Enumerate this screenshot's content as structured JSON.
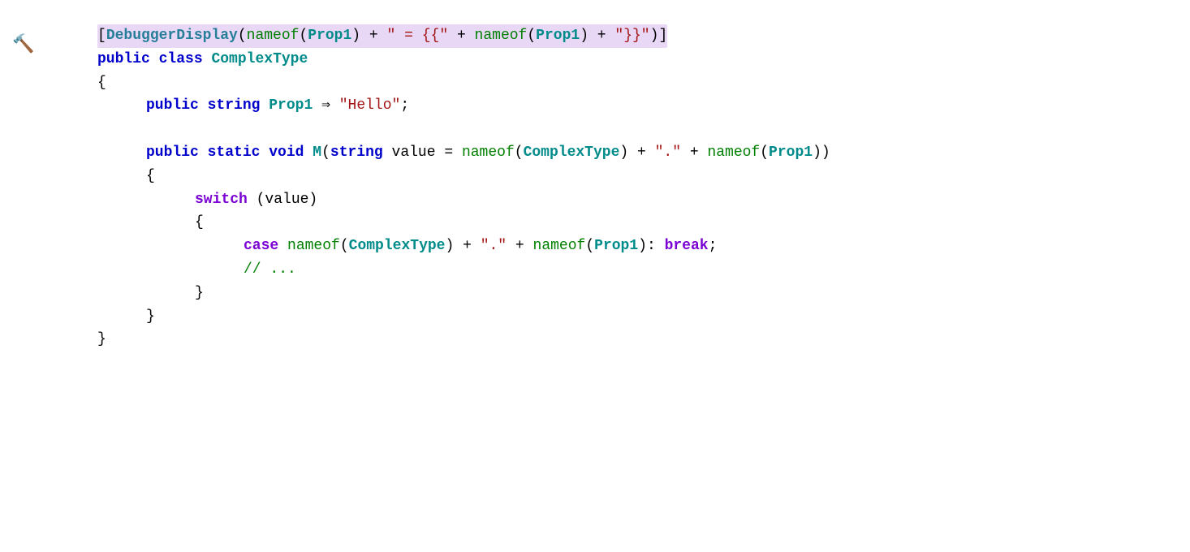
{
  "code": {
    "lines": [
      {
        "id": "line1",
        "indent": 0,
        "tokens": [
          {
            "text": "[",
            "class": "punct",
            "highlight": true
          },
          {
            "text": "DebuggerDisplay",
            "class": "attr-class",
            "highlight": true
          },
          {
            "text": "(",
            "class": "punct",
            "highlight": true
          },
          {
            "text": "nameof",
            "class": "kw-green",
            "highlight": true
          },
          {
            "text": "(",
            "class": "punct",
            "highlight": true
          },
          {
            "text": "Prop1",
            "class": "kw-teal",
            "highlight": true
          },
          {
            "text": ")",
            "class": "punct",
            "highlight": true
          },
          {
            "text": " + ",
            "class": "plain",
            "highlight": true
          },
          {
            "text": "\" = {{\"",
            "class": "str-red",
            "highlight": true
          },
          {
            "text": " + ",
            "class": "plain",
            "highlight": true
          },
          {
            "text": "nameof",
            "class": "kw-green",
            "highlight": true
          },
          {
            "text": "(",
            "class": "punct",
            "highlight": true
          },
          {
            "text": "Prop1",
            "class": "kw-teal",
            "highlight": true
          },
          {
            "text": ")",
            "class": "punct",
            "highlight": true
          },
          {
            "text": " + ",
            "class": "plain",
            "highlight": true
          },
          {
            "text": "\"}}\"",
            "class": "str-red",
            "highlight": true
          },
          {
            "text": ")",
            "class": "punct",
            "highlight": true
          },
          {
            "text": "]",
            "class": "punct",
            "highlight": true
          }
        ]
      },
      {
        "id": "line2",
        "indent": 0,
        "tokens": [
          {
            "text": "public",
            "class": "kw-blue"
          },
          {
            "text": " ",
            "class": "plain"
          },
          {
            "text": "class",
            "class": "kw-blue"
          },
          {
            "text": " ",
            "class": "plain"
          },
          {
            "text": "ComplexType",
            "class": "kw-teal"
          }
        ]
      },
      {
        "id": "line3",
        "indent": 0,
        "tokens": [
          {
            "text": "{",
            "class": "plain"
          }
        ]
      },
      {
        "id": "line4",
        "indent": 1,
        "tokens": [
          {
            "text": "public",
            "class": "kw-blue"
          },
          {
            "text": " ",
            "class": "plain"
          },
          {
            "text": "string",
            "class": "kw-blue"
          },
          {
            "text": " ",
            "class": "plain"
          },
          {
            "text": "Prop1",
            "class": "kw-teal"
          },
          {
            "text": " ⇒ ",
            "class": "plain"
          },
          {
            "text": "\"Hello\"",
            "class": "str-red"
          },
          {
            "text": ";",
            "class": "plain"
          }
        ]
      },
      {
        "id": "line5",
        "indent": 0,
        "tokens": []
      },
      {
        "id": "line6",
        "indent": 1,
        "tokens": [
          {
            "text": "public",
            "class": "kw-blue"
          },
          {
            "text": " ",
            "class": "plain"
          },
          {
            "text": "static",
            "class": "kw-blue"
          },
          {
            "text": " ",
            "class": "plain"
          },
          {
            "text": "void",
            "class": "kw-blue"
          },
          {
            "text": " ",
            "class": "plain"
          },
          {
            "text": "M",
            "class": "kw-teal"
          },
          {
            "text": "(",
            "class": "plain"
          },
          {
            "text": "string",
            "class": "kw-blue"
          },
          {
            "text": " value = ",
            "class": "plain"
          },
          {
            "text": "nameof",
            "class": "kw-green"
          },
          {
            "text": "(",
            "class": "plain"
          },
          {
            "text": "ComplexType",
            "class": "kw-teal"
          },
          {
            "text": ")",
            "class": "plain"
          },
          {
            "text": " + ",
            "class": "plain"
          },
          {
            "text": "\".\"",
            "class": "str-red"
          },
          {
            "text": " + ",
            "class": "plain"
          },
          {
            "text": "nameof",
            "class": "kw-green"
          },
          {
            "text": "(",
            "class": "plain"
          },
          {
            "text": "Prop1",
            "class": "kw-teal"
          },
          {
            "text": "))",
            "class": "plain"
          }
        ]
      },
      {
        "id": "line7",
        "indent": 1,
        "tokens": [
          {
            "text": "{",
            "class": "plain"
          }
        ]
      },
      {
        "id": "line8",
        "indent": 2,
        "tokens": [
          {
            "text": "switch",
            "class": "kw-purple"
          },
          {
            "text": " (value)",
            "class": "plain"
          }
        ]
      },
      {
        "id": "line9",
        "indent": 2,
        "tokens": [
          {
            "text": "{",
            "class": "plain"
          }
        ]
      },
      {
        "id": "line10",
        "indent": 3,
        "tokens": [
          {
            "text": "case",
            "class": "kw-purple"
          },
          {
            "text": " ",
            "class": "plain"
          },
          {
            "text": "nameof",
            "class": "kw-green"
          },
          {
            "text": "(",
            "class": "plain"
          },
          {
            "text": "ComplexType",
            "class": "kw-teal"
          },
          {
            "text": ")",
            "class": "plain"
          },
          {
            "text": " + ",
            "class": "plain"
          },
          {
            "text": "\".\"",
            "class": "str-red"
          },
          {
            "text": " + ",
            "class": "plain"
          },
          {
            "text": "nameof",
            "class": "kw-green"
          },
          {
            "text": "(",
            "class": "plain"
          },
          {
            "text": "Prop1",
            "class": "kw-teal"
          },
          {
            "text": "): ",
            "class": "plain"
          },
          {
            "text": "break",
            "class": "kw-purple"
          },
          {
            "text": ";",
            "class": "plain"
          }
        ]
      },
      {
        "id": "line11",
        "indent": 3,
        "tokens": [
          {
            "text": "// ...",
            "class": "comment"
          }
        ]
      },
      {
        "id": "line12",
        "indent": 2,
        "tokens": [
          {
            "text": "}",
            "class": "plain"
          }
        ]
      },
      {
        "id": "line13",
        "indent": 1,
        "tokens": [
          {
            "text": "}",
            "class": "plain"
          }
        ]
      },
      {
        "id": "line14",
        "indent": 0,
        "tokens": [
          {
            "text": "}",
            "class": "plain"
          }
        ]
      }
    ]
  }
}
